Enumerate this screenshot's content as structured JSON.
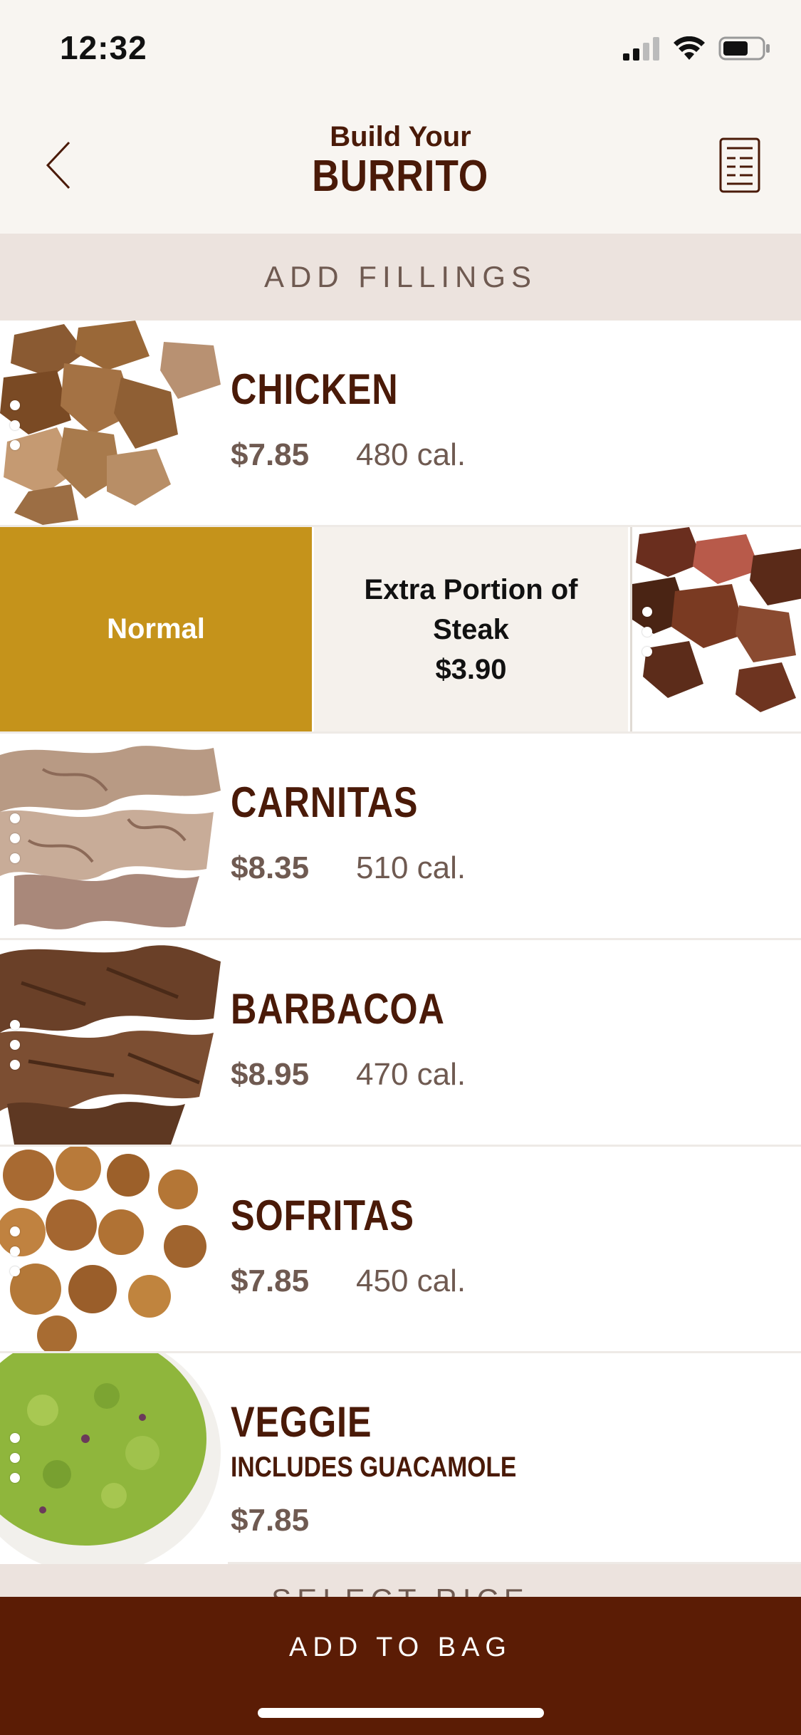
{
  "status": {
    "time": "12:32"
  },
  "header": {
    "title_small": "Build Your",
    "title_big": "BURRITO"
  },
  "section": {
    "title": "ADD FILLINGS"
  },
  "items": [
    {
      "name": "CHICKEN",
      "price": "$7.85",
      "cal": "480 cal."
    },
    {
      "name": "CARNITAS",
      "price": "$8.35",
      "cal": "510 cal."
    },
    {
      "name": "BARBACOA",
      "price": "$8.95",
      "cal": "470 cal."
    },
    {
      "name": "SOFRITAS",
      "price": "$7.85",
      "cal": "450 cal."
    },
    {
      "name": "VEGGIE",
      "sub": "INCLUDES GUACAMOLE",
      "price": "$7.85"
    }
  ],
  "steak_options": {
    "normal": "Normal",
    "extra_label": "Extra Portion of Steak",
    "extra_price": "$3.90"
  },
  "next_section": {
    "title": "SELECT RICE"
  },
  "footer": {
    "add_label": "ADD TO BAG"
  },
  "colors": {
    "accent_gold": "#c5931b",
    "brand_brown": "#5b1c05",
    "title_brown": "#4a1a08",
    "section_bg": "#ece3de"
  }
}
